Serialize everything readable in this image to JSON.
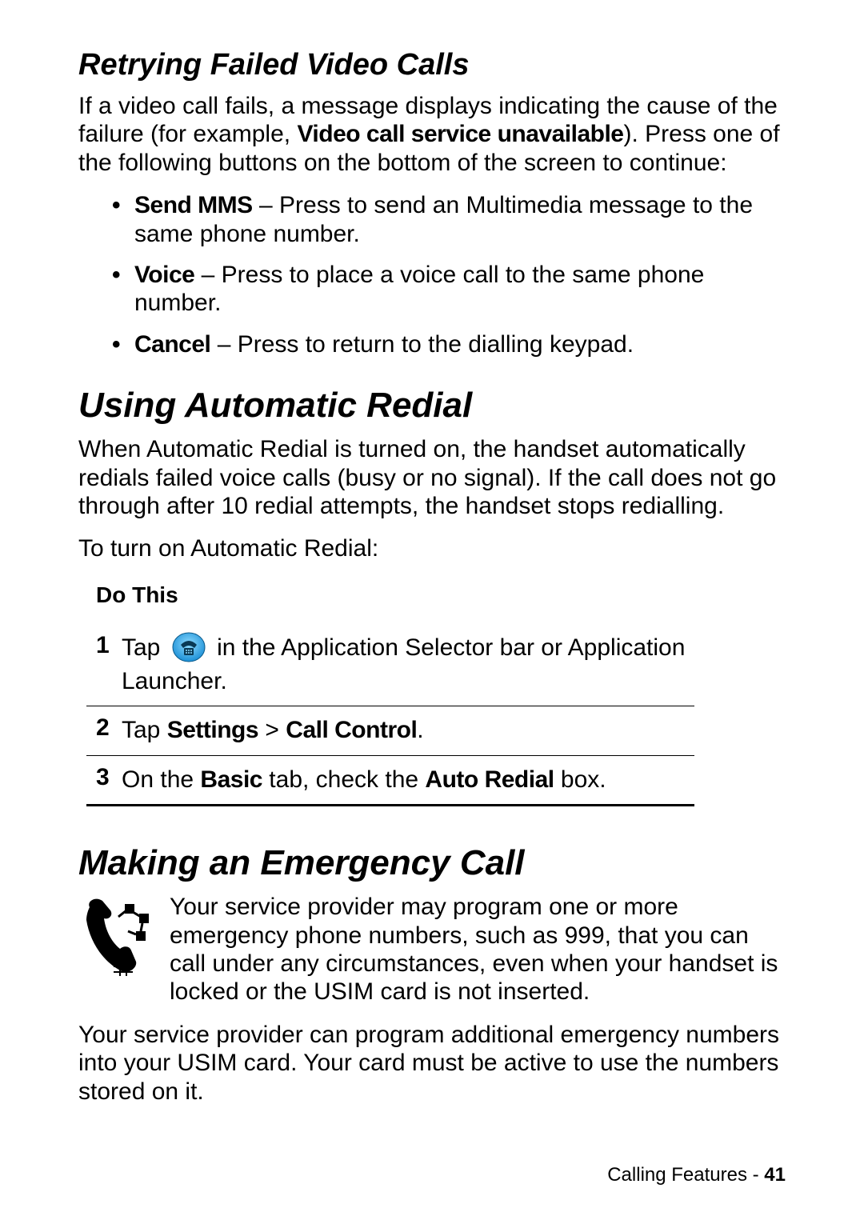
{
  "section1": {
    "title": "Retrying Failed Video Calls",
    "intro_pre": "If a video call fails, a message displays indicating the cause of the failure (for example, ",
    "intro_bold": "Video call service unavailable",
    "intro_post": "). Press one of the following buttons on the bottom of the screen to continue:",
    "bullets": [
      {
        "label": "Send MMS",
        "text": " – Press to send an Multimedia message to the same phone number."
      },
      {
        "label": "Voice",
        "text": " – Press to place a voice call to the same phone number."
      },
      {
        "label": "Cancel",
        "text": " – Press to return to the dialling keypad."
      }
    ]
  },
  "section2": {
    "title": "Using Automatic Redial",
    "para1": "When Automatic Redial is turned on, the handset automatically redials failed voice calls (busy or no signal). If the call does not go through after 10 redial attempts, the handset stops redialling.",
    "para2": "To turn on Automatic Redial:",
    "do_this": "Do This",
    "steps": {
      "s1_pre": "Tap ",
      "s1_post": " in the Application Selector bar or Application Launcher.",
      "s2_pre": "Tap ",
      "s2_b1": "Settings",
      "s2_mid": " > ",
      "s2_b2": "Call Control",
      "s2_post": ".",
      "s3_pre": "On the ",
      "s3_b1": "Basic",
      "s3_mid": " tab, check the ",
      "s3_b2": "Auto Redial",
      "s3_post": " box."
    },
    "nums": [
      "1",
      "2",
      "3"
    ]
  },
  "section3": {
    "title": "Making an Emergency Call",
    "para_icon": "Your service provider may program one or more emergency phone numbers, such as 999, that you can call under any circumstances, even when your handset is locked or the USIM card is not inserted.",
    "para2": "Your service provider can program additional emergency numbers into your USIM card. Your card must be active to use the numbers stored on it."
  },
  "footer": {
    "label": "Calling Features - ",
    "page": "41"
  }
}
